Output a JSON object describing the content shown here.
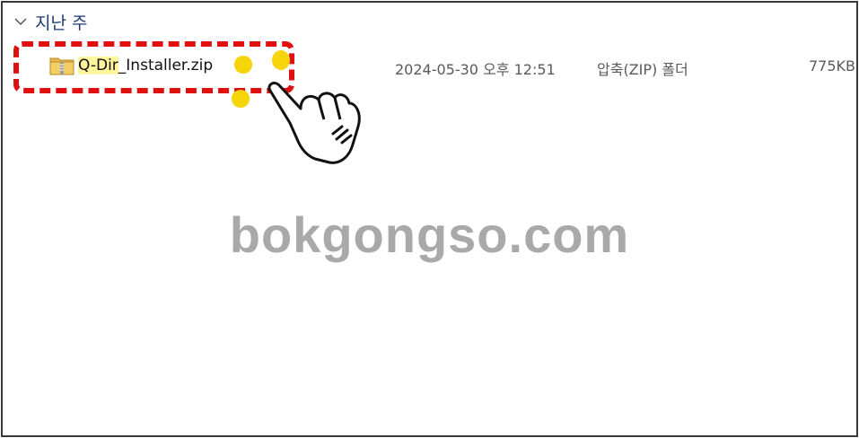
{
  "group": {
    "title": "지난 주"
  },
  "file": {
    "name_highlighted": "Q-Dir",
    "name_rest": "_Installer.zip",
    "modified": "2024-05-30 오후 12:51",
    "type": "압축(ZIP) 폴더",
    "size": "775KB",
    "icon": "zip-folder-icon"
  },
  "watermark": {
    "text": "bokgongso.com"
  },
  "colors": {
    "annotation_box": "#e01010",
    "highlight": "#fff59a",
    "dots": "#f5d40a",
    "group_header": "#1e3a73"
  }
}
